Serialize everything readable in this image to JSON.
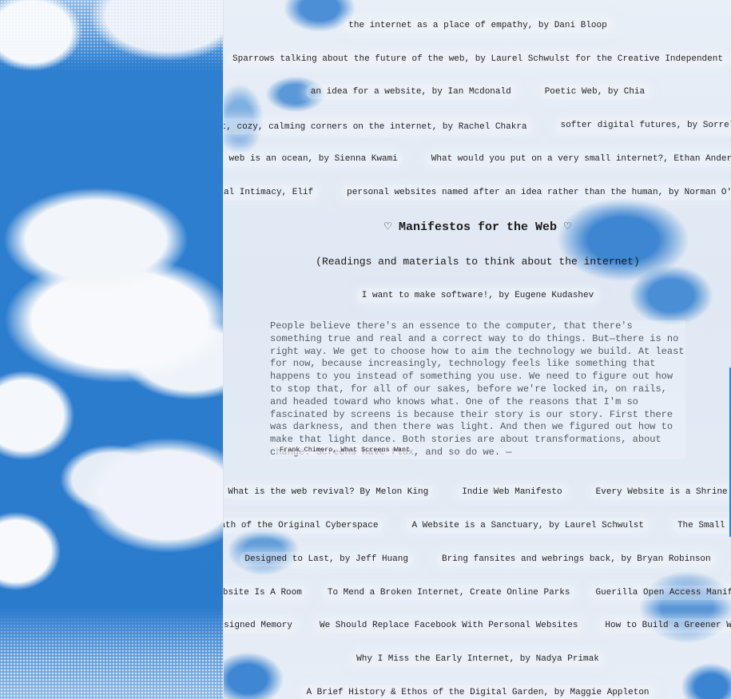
{
  "colors": {
    "sky_blue": "#2f7fd0",
    "cloud_white": "#f4f7fb",
    "text": "#1f1f1f",
    "quote_text": "#555a63"
  },
  "top_links": [
    [
      "the internet as a place of empathy, by Dani Bloop"
    ],
    [
      "Sparrows talking about the future of the web, by Laurel Schwulst for the Creative Independent"
    ],
    [
      "an idea for a website, by Ian Mcdonald",
      "Poetic Web, by Chia"
    ],
    [
      "✧ soft, cozy, calming corners on the internet, by Rachel Chakra",
      "softer digital futures, by Sorrel Salb"
    ],
    [
      "the web is an ocean, by Sienna Kwami",
      "What would you put on a very small internet?, Ethan Anderson"
    ],
    [
      "Digital Intimacy, Elif",
      "personal websites named after an idea rather than the human, by Norman O'Hagan"
    ]
  ],
  "manifesto": {
    "heading": "♡ Manifestos for the Web ♡",
    "subheading": "(Readings and materials to think about the internet)",
    "featured_link": "I want to make software!, by Eugene Kudashev",
    "quote": "People believe there's an essence to the computer, that there's something true and real and a correct way to do things. But—there is no right way. We get to choose how to aim the technology we build. At least for now, because increasingly, technology feels like something that happens to you instead of something you use. We need to figure out how to stop that, for all of our sakes, before we're locked in, on rails, and headed toward who knows what. One of the reasons that I'm so fascinated by screens is because their story is our story. First there was darkness, and then there was light. And then we figured out how to make that light dance. Both stories are about transformations, about change. Screens have flux, and so do we. —",
    "quote_source": "Frank Chimero, What Screens Want"
  },
  "manifesto_links": [
    [
      "What is the web revival? By Melon King",
      "Indie Web Manifesto",
      "Every Website is a Shrine"
    ],
    [
      "Death of the Original Cyberspace",
      "A Website is a Sanctuary, by Laurel Schwulst",
      "The Small Web"
    ],
    [
      "Designed to Last, by Jeff Huang",
      "Bring fansites and webrings back, by Bryan Robinson"
    ],
    [
      "A Website Is A Room",
      "To Mend a Broken Internet, Create Online Parks",
      "Guerilla Open Access Manifesto"
    ],
    [
      "Designed Memory",
      "We Should Replace Facebook With Personal Websites",
      "How to Build a Greener Web"
    ],
    [
      "Why I Miss the Early Internet, by Nadya Primak"
    ],
    [
      "A Brief History & Ethos of the Digital Garden, by Maggie Appleton"
    ]
  ]
}
